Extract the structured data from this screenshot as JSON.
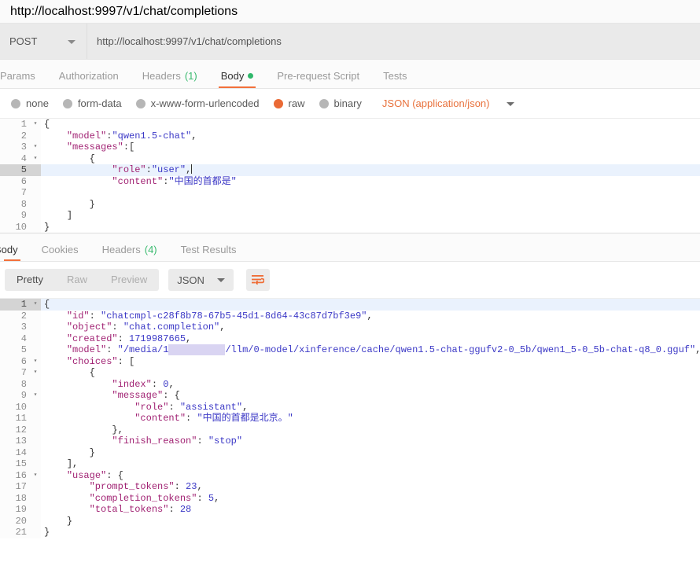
{
  "titlebar": {
    "url": "http://localhost:9997/v1/chat/completions"
  },
  "request_bar": {
    "method": "POST",
    "method_caret": "chevron-down-icon",
    "url": "http://localhost:9997/v1/chat/completions"
  },
  "request_tabs": [
    {
      "label": "Params",
      "active": false
    },
    {
      "label": "Authorization",
      "active": false
    },
    {
      "label": "Headers",
      "count": "(1)",
      "active": false
    },
    {
      "label": "Body",
      "active": true,
      "dot": true
    },
    {
      "label": "Pre-request Script",
      "active": false
    },
    {
      "label": "Tests",
      "active": false
    }
  ],
  "body_types": [
    {
      "label": "none",
      "selected": false
    },
    {
      "label": "form-data",
      "selected": false
    },
    {
      "label": "x-www-form-urlencoded",
      "selected": false
    },
    {
      "label": "raw",
      "selected": true
    },
    {
      "label": "binary",
      "selected": false
    }
  ],
  "content_type": "JSON (application/json)",
  "request_body_lines": [
    {
      "num": "1",
      "fold": "▾",
      "hl": false,
      "tokens": [
        {
          "t": "{",
          "c": "p"
        }
      ]
    },
    {
      "num": "2",
      "fold": "",
      "hl": false,
      "tokens": [
        {
          "t": "    ",
          "c": "p"
        },
        {
          "t": "\"model\"",
          "c": "k"
        },
        {
          "t": ":",
          "c": "p"
        },
        {
          "t": "\"qwen1.5-chat\"",
          "c": "s"
        },
        {
          "t": ",",
          "c": "p"
        }
      ]
    },
    {
      "num": "3",
      "fold": "▾",
      "hl": false,
      "tokens": [
        {
          "t": "    ",
          "c": "p"
        },
        {
          "t": "\"messages\"",
          "c": "k"
        },
        {
          "t": ":",
          "c": "p"
        },
        {
          "t": "[",
          "c": "p"
        }
      ]
    },
    {
      "num": "4",
      "fold": "▾",
      "hl": false,
      "tokens": [
        {
          "t": "        ",
          "c": "p"
        },
        {
          "t": "{",
          "c": "p"
        }
      ]
    },
    {
      "num": "5",
      "fold": "",
      "hl": true,
      "caret": true,
      "tokens": [
        {
          "t": "            ",
          "c": "p"
        },
        {
          "t": "\"role\"",
          "c": "k"
        },
        {
          "t": ":",
          "c": "p"
        },
        {
          "t": "\"user\"",
          "c": "s"
        },
        {
          "t": ",",
          "c": "p"
        }
      ]
    },
    {
      "num": "6",
      "fold": "",
      "hl": false,
      "tokens": [
        {
          "t": "            ",
          "c": "p"
        },
        {
          "t": "\"content\"",
          "c": "k"
        },
        {
          "t": ":",
          "c": "p"
        },
        {
          "t": "\"中国的首都是\"",
          "c": "s"
        }
      ]
    },
    {
      "num": "7",
      "fold": "",
      "hl": false,
      "tokens": []
    },
    {
      "num": "8",
      "fold": "",
      "hl": false,
      "tokens": [
        {
          "t": "        ",
          "c": "p"
        },
        {
          "t": "}",
          "c": "p"
        }
      ]
    },
    {
      "num": "9",
      "fold": "",
      "hl": false,
      "tokens": [
        {
          "t": "    ",
          "c": "p"
        },
        {
          "t": "]",
          "c": "p"
        }
      ]
    },
    {
      "num": "10",
      "fold": "",
      "hl": false,
      "tokens": [
        {
          "t": "}",
          "c": "p"
        }
      ]
    }
  ],
  "response_tabs": [
    {
      "label": "Body",
      "active": true,
      "clipped": true
    },
    {
      "label": "Cookies",
      "active": false
    },
    {
      "label": "Headers",
      "count": "(4)",
      "active": false
    },
    {
      "label": "Test Results",
      "active": false
    }
  ],
  "response_toolbar": {
    "segments": [
      {
        "label": "Pretty",
        "active": true
      },
      {
        "label": "Raw",
        "active": false
      },
      {
        "label": "Preview",
        "active": false
      }
    ],
    "format": "JSON",
    "format_caret": "chevron-down-icon",
    "wrap_icon": "word-wrap-icon"
  },
  "response_body_lines": [
    {
      "num": "1",
      "fold": "▾",
      "hl": true,
      "tokens": [
        {
          "t": "{",
          "c": "p"
        }
      ]
    },
    {
      "num": "2",
      "fold": "",
      "hl": false,
      "tokens": [
        {
          "t": "    ",
          "c": "p"
        },
        {
          "t": "\"id\"",
          "c": "k"
        },
        {
          "t": ": ",
          "c": "p"
        },
        {
          "t": "\"chatcmpl-c28f8b78-67b5-45d1-8d64-43c87d7bf3e9\"",
          "c": "s"
        },
        {
          "t": ",",
          "c": "p"
        }
      ]
    },
    {
      "num": "3",
      "fold": "",
      "hl": false,
      "tokens": [
        {
          "t": "    ",
          "c": "p"
        },
        {
          "t": "\"object\"",
          "c": "k"
        },
        {
          "t": ": ",
          "c": "p"
        },
        {
          "t": "\"chat.completion\"",
          "c": "s"
        },
        {
          "t": ",",
          "c": "p"
        }
      ]
    },
    {
      "num": "4",
      "fold": "",
      "hl": false,
      "tokens": [
        {
          "t": "    ",
          "c": "p"
        },
        {
          "t": "\"created\"",
          "c": "k"
        },
        {
          "t": ": ",
          "c": "p"
        },
        {
          "t": "1719987665",
          "c": "n"
        },
        {
          "t": ",",
          "c": "p"
        }
      ]
    },
    {
      "num": "5",
      "fold": "",
      "hl": false,
      "tokens": [
        {
          "t": "    ",
          "c": "p"
        },
        {
          "t": "\"model\"",
          "c": "k"
        },
        {
          "t": ": ",
          "c": "p"
        },
        {
          "t": "\"/media/1",
          "c": "s"
        },
        {
          "t": "xxxxxxxxxx",
          "c": "redact"
        },
        {
          "t": "/llm/0-model/xinference/cache/qwen1.5-chat-ggufv2-0_5b/qwen1_5-0_5b-chat-q8_0.gguf\"",
          "c": "s"
        },
        {
          "t": ",",
          "c": "p"
        }
      ]
    },
    {
      "num": "6",
      "fold": "▾",
      "hl": false,
      "tokens": [
        {
          "t": "    ",
          "c": "p"
        },
        {
          "t": "\"choices\"",
          "c": "k"
        },
        {
          "t": ": ",
          "c": "p"
        },
        {
          "t": "[",
          "c": "p"
        }
      ]
    },
    {
      "num": "7",
      "fold": "▾",
      "hl": false,
      "tokens": [
        {
          "t": "        ",
          "c": "p"
        },
        {
          "t": "{",
          "c": "p"
        }
      ]
    },
    {
      "num": "8",
      "fold": "",
      "hl": false,
      "tokens": [
        {
          "t": "            ",
          "c": "p"
        },
        {
          "t": "\"index\"",
          "c": "k"
        },
        {
          "t": ": ",
          "c": "p"
        },
        {
          "t": "0",
          "c": "n"
        },
        {
          "t": ",",
          "c": "p"
        }
      ]
    },
    {
      "num": "9",
      "fold": "▾",
      "hl": false,
      "tokens": [
        {
          "t": "            ",
          "c": "p"
        },
        {
          "t": "\"message\"",
          "c": "k"
        },
        {
          "t": ": ",
          "c": "p"
        },
        {
          "t": "{",
          "c": "p"
        }
      ]
    },
    {
      "num": "10",
      "fold": "",
      "hl": false,
      "tokens": [
        {
          "t": "                ",
          "c": "p"
        },
        {
          "t": "\"role\"",
          "c": "k"
        },
        {
          "t": ": ",
          "c": "p"
        },
        {
          "t": "\"assistant\"",
          "c": "s"
        },
        {
          "t": ",",
          "c": "p"
        }
      ]
    },
    {
      "num": "11",
      "fold": "",
      "hl": false,
      "tokens": [
        {
          "t": "                ",
          "c": "p"
        },
        {
          "t": "\"content\"",
          "c": "k"
        },
        {
          "t": ": ",
          "c": "p"
        },
        {
          "t": "\"中国的首都是北京。\"",
          "c": "s"
        }
      ]
    },
    {
      "num": "12",
      "fold": "",
      "hl": false,
      "tokens": [
        {
          "t": "            ",
          "c": "p"
        },
        {
          "t": "},",
          "c": "p"
        }
      ]
    },
    {
      "num": "13",
      "fold": "",
      "hl": false,
      "tokens": [
        {
          "t": "            ",
          "c": "p"
        },
        {
          "t": "\"finish_reason\"",
          "c": "k"
        },
        {
          "t": ": ",
          "c": "p"
        },
        {
          "t": "\"stop\"",
          "c": "s"
        }
      ]
    },
    {
      "num": "14",
      "fold": "",
      "hl": false,
      "tokens": [
        {
          "t": "        ",
          "c": "p"
        },
        {
          "t": "}",
          "c": "p"
        }
      ]
    },
    {
      "num": "15",
      "fold": "",
      "hl": false,
      "tokens": [
        {
          "t": "    ",
          "c": "p"
        },
        {
          "t": "],",
          "c": "p"
        }
      ]
    },
    {
      "num": "16",
      "fold": "▾",
      "hl": false,
      "tokens": [
        {
          "t": "    ",
          "c": "p"
        },
        {
          "t": "\"usage\"",
          "c": "k"
        },
        {
          "t": ": ",
          "c": "p"
        },
        {
          "t": "{",
          "c": "p"
        }
      ]
    },
    {
      "num": "17",
      "fold": "",
      "hl": false,
      "tokens": [
        {
          "t": "        ",
          "c": "p"
        },
        {
          "t": "\"prompt_tokens\"",
          "c": "k"
        },
        {
          "t": ": ",
          "c": "p"
        },
        {
          "t": "23",
          "c": "n"
        },
        {
          "t": ",",
          "c": "p"
        }
      ]
    },
    {
      "num": "18",
      "fold": "",
      "hl": false,
      "tokens": [
        {
          "t": "        ",
          "c": "p"
        },
        {
          "t": "\"completion_tokens\"",
          "c": "k"
        },
        {
          "t": ": ",
          "c": "p"
        },
        {
          "t": "5",
          "c": "n"
        },
        {
          "t": ",",
          "c": "p"
        }
      ]
    },
    {
      "num": "19",
      "fold": "",
      "hl": false,
      "tokens": [
        {
          "t": "        ",
          "c": "p"
        },
        {
          "t": "\"total_tokens\"",
          "c": "k"
        },
        {
          "t": ": ",
          "c": "p"
        },
        {
          "t": "28",
          "c": "n"
        }
      ]
    },
    {
      "num": "20",
      "fold": "",
      "hl": false,
      "tokens": [
        {
          "t": "    ",
          "c": "p"
        },
        {
          "t": "}",
          "c": "p"
        }
      ]
    },
    {
      "num": "21",
      "fold": "",
      "hl": false,
      "tokens": [
        {
          "t": "}",
          "c": "p"
        }
      ]
    }
  ],
  "colors": {
    "accent_orange": "#f2703b",
    "content_type_orange": "#e8713c",
    "radio_selected": "#ea6a35",
    "green_dot": "#30b86b",
    "count_green": "#3aba6f",
    "key_purple": "#a12273",
    "string_blue": "#3b38c6",
    "active_line": "#eaf2fd"
  }
}
